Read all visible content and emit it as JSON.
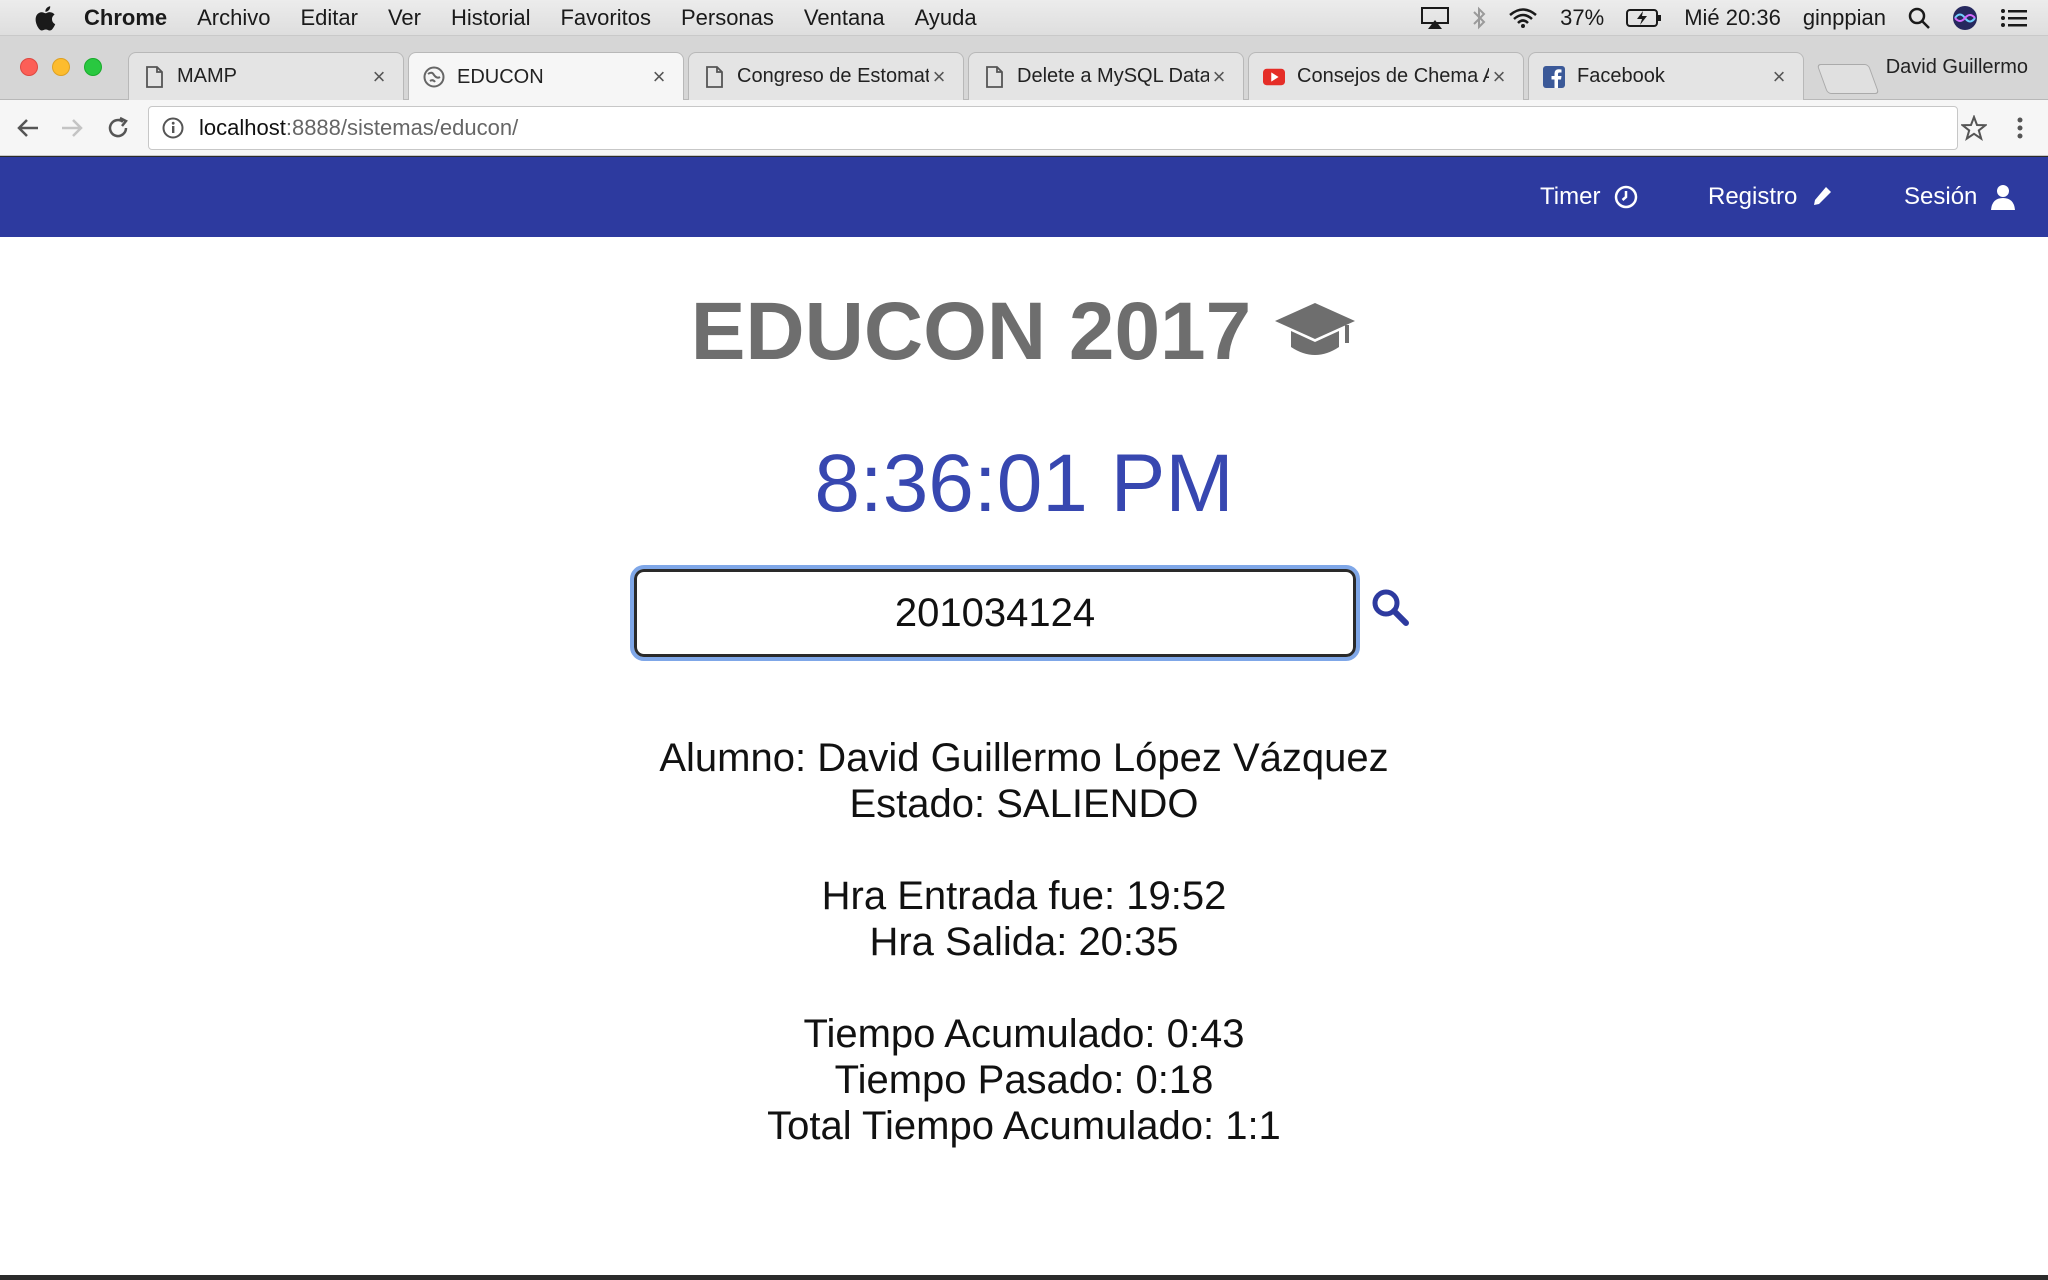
{
  "menubar": {
    "app": "Chrome",
    "items": [
      "Archivo",
      "Editar",
      "Ver",
      "Historial",
      "Favoritos",
      "Personas",
      "Ventana",
      "Ayuda"
    ],
    "battery": "37%",
    "datetime": "Mié 20:36",
    "user": "ginppian"
  },
  "tabs": [
    {
      "title": "MAMP",
      "icon": "page-icon"
    },
    {
      "title": "EDUCON",
      "icon": "globe-icon"
    },
    {
      "title": "Congreso de Estomat",
      "icon": "page-icon"
    },
    {
      "title": "Delete a MySQL Data",
      "icon": "page-icon"
    },
    {
      "title": "Consejos de Chema A",
      "icon": "youtube-icon"
    },
    {
      "title": "Facebook",
      "icon": "facebook-icon"
    }
  ],
  "profile_name": "David Guillermo",
  "address": {
    "host": "localhost",
    "path": ":8888/sistemas/educon/"
  },
  "navbar": {
    "timer": "Timer",
    "registro": "Registro",
    "sesion": "Sesión"
  },
  "page": {
    "title": "EDUCON 2017",
    "clock": "8:36:01 PM",
    "search_value": "201034124",
    "alumno": "Alumno: David Guillermo López Vázquez",
    "estado": "Estado: SALIENDO",
    "entrada": "Hra Entrada fue: 19:52",
    "salida": "Hra Salida: 20:35",
    "acumulado": "Tiempo Acumulado: 0:43",
    "pasado": "Tiempo Pasado: 0:18",
    "total": "Total Tiempo Acumulado: 1:1"
  },
  "colors": {
    "navbar": "#2d3a9f",
    "clock": "#3747b0",
    "title": "#6e6e6e",
    "focus_ring": "#7fa7e8"
  }
}
